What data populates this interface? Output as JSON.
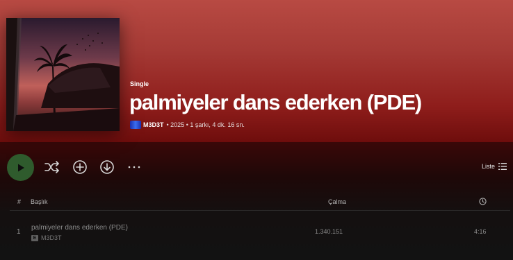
{
  "album": {
    "type_label": "Single",
    "title": "palmiyeler dans ederken (PDE)",
    "artist": "M3D3T",
    "meta_rest": "• 2025 • 1 şarkı, 4 dk. 16 sn."
  },
  "controls": {
    "play_icon": "play-icon",
    "shuffle_icon": "shuffle-icon",
    "add_icon": "add-circle-icon",
    "download_icon": "download-circle-icon",
    "more_icon": "more-dots-icon",
    "view_label": "Liste"
  },
  "table": {
    "headers": {
      "number": "#",
      "title": "Başlık",
      "plays": "Çalma"
    },
    "rows": [
      {
        "number": "1",
        "title": "palmiyeler dans ederken (PDE)",
        "explicit": "E",
        "artist": "M3D3T",
        "plays": "1.340.151",
        "duration": "4:16"
      }
    ]
  },
  "colors": {
    "hero": "#a53a35",
    "play": "#2f5b2d",
    "background": "#121212"
  }
}
